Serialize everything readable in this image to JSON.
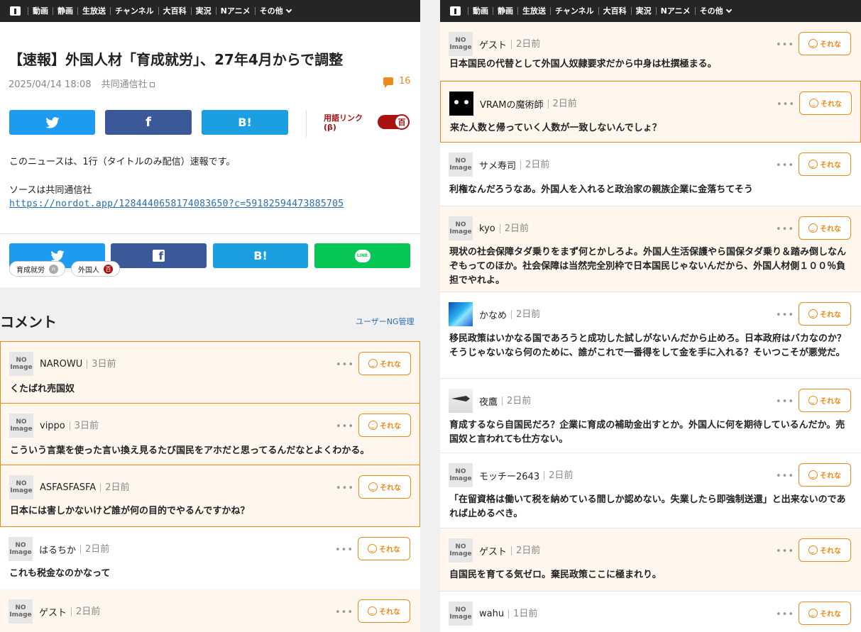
{
  "nav": {
    "items": [
      "動画",
      "静画",
      "生放送",
      "チャンネル",
      "大百科",
      "実況",
      "Nアニメ",
      "その他"
    ]
  },
  "article": {
    "title": "【速報】外国人材「育成就労」、27年4月からで調整",
    "datetime": "2025/04/14 18:08",
    "source": "共同通信社",
    "comment_count": "16",
    "glossary_label": "用語リンク\n(β)",
    "toggle_glyph": "百",
    "body_line1": "このニュースは、1行（タイトルのみ配信）速報です。",
    "body_line2": "ソースは共同通信社",
    "link": "https://nordot.app/1284440658174083650?c=59182594473885705",
    "share_hatena": "B!",
    "share_line": "LINE",
    "tags": [
      {
        "label": "育成就労",
        "icon": "n"
      },
      {
        "label": "外国人",
        "icon": "百"
      }
    ]
  },
  "comments_section": {
    "heading": "コメント",
    "ng_link": "ユーザーNG管理",
    "reaction_label": "それな",
    "no_image": "NO\nImage"
  },
  "left_comments": [
    {
      "user": "NAROWU",
      "ago": "3日前",
      "text": "くたばれ売国奴"
    },
    {
      "user": "vippo",
      "ago": "3日前",
      "text": "こういう言葉を使った言い換え見るたび国民をアホだと思ってるんだなとよくわかる。"
    },
    {
      "user": "ASFASFASFA",
      "ago": "2日前",
      "text": "日本には害しかないけど誰が何の目的でやるんですかね？"
    },
    {
      "user": "はるちか",
      "ago": "2日前",
      "text": "これも税金なのかなって"
    },
    {
      "user": "ゲスト",
      "ago": "2日前",
      "text": ""
    }
  ],
  "right_comments": [
    {
      "user": "ゲスト",
      "ago": "2日前",
      "text": "日本国民の代替として外国人奴隷要求だから中身は杜撰極まる。"
    },
    {
      "user": "VRAMの魔術師",
      "ago": "2日前",
      "text": "来た人数と帰っていく人数が一致しないんでしょ？"
    },
    {
      "user": "サメ寿司",
      "ago": "2日前",
      "text": "利権なんだろうなあ。外国人を入れると政治家の親族企業に金落ちてそう"
    },
    {
      "user": "kyo",
      "ago": "2日前",
      "text": "現状の社会保障タダ乗りをまず何とかしろよ。外国人生活保護やら国保タダ乗り＆踏み倒しなんぞもってのほか。社会保障は当然完全別枠で日本国民じゃないんだから、外国人材側１００％負担でやれよ。"
    },
    {
      "user": "かなめ",
      "ago": "2日前",
      "text": "移民政策はいかなる国であろうと成功した試しがないんだから止めろ。日本政府はバカなのか？そうじゃないなら何のために、誰がこれで一番得をして金を手に入れる？そいつこそが悪党だ。"
    },
    {
      "user": "夜鷹",
      "ago": "2日前",
      "text": "育成するなら自国民だろ？企業に育成の補助金出すとか。外国人に何を期待しているんだか。売国奴と言われても仕方ない。"
    },
    {
      "user": "モッチー2643",
      "ago": "2日前",
      "text": "「在留資格は働いて税を納めている間しか認めない。失業したら即強制送還」と出来ないのであれば止めるべき。"
    },
    {
      "user": "ゲスト",
      "ago": "2日前",
      "text": "自国民を育てる気ゼロ。棄民政策ここに極まれり。"
    },
    {
      "user": "wahu",
      "ago": "1日前",
      "text": ""
    }
  ]
}
